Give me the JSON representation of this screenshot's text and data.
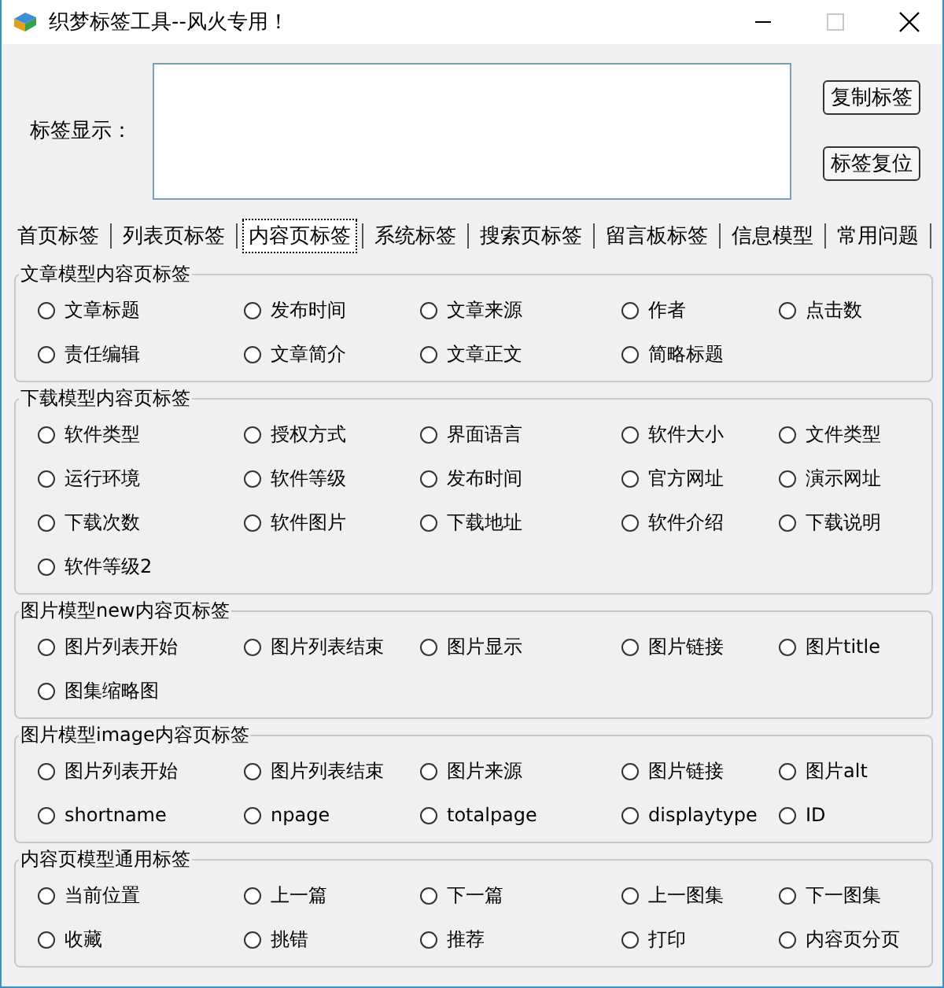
{
  "window": {
    "title": "织梦标签工具--风火专用！"
  },
  "display": {
    "label": "标签显示："
  },
  "buttons": [
    "复制标签",
    "标签复位"
  ],
  "tabs": [
    {
      "label": "首页标签",
      "selected": false
    },
    {
      "label": "列表页标签",
      "selected": false
    },
    {
      "label": "内容页标签",
      "selected": true
    },
    {
      "label": "系统标签",
      "selected": false
    },
    {
      "label": "搜索页标签",
      "selected": false
    },
    {
      "label": "留言板标签",
      "selected": false
    },
    {
      "label": "信息模型",
      "selected": false
    },
    {
      "label": "常用问题",
      "selected": false
    }
  ],
  "groups": [
    {
      "title": "文章模型内容页标签",
      "options": [
        {
          "label": "文章标题",
          "selected": false
        },
        {
          "label": "发布时间",
          "selected": false
        },
        {
          "label": "文章来源",
          "selected": false
        },
        {
          "label": "作者",
          "selected": false
        },
        {
          "label": "点击数",
          "selected": false
        },
        {
          "label": "责任编辑",
          "selected": false
        },
        {
          "label": "文章简介",
          "selected": false
        },
        {
          "label": "文章正文",
          "selected": false
        },
        {
          "label": "简略标题",
          "selected": false
        }
      ]
    },
    {
      "title": "下载模型内容页标签",
      "options": [
        {
          "label": "软件类型",
          "selected": false
        },
        {
          "label": "授权方式",
          "selected": false
        },
        {
          "label": "界面语言",
          "selected": false
        },
        {
          "label": "软件大小",
          "selected": false
        },
        {
          "label": "文件类型",
          "selected": false
        },
        {
          "label": "运行环境",
          "selected": false
        },
        {
          "label": "软件等级",
          "selected": false
        },
        {
          "label": "发布时间",
          "selected": false
        },
        {
          "label": "官方网址",
          "selected": false
        },
        {
          "label": "演示网址",
          "selected": false
        },
        {
          "label": "下载次数",
          "selected": false
        },
        {
          "label": "软件图片",
          "selected": false
        },
        {
          "label": "下载地址",
          "selected": false
        },
        {
          "label": "软件介绍",
          "selected": false
        },
        {
          "label": "下载说明",
          "selected": false
        },
        {
          "label": "软件等级2",
          "selected": false
        }
      ]
    },
    {
      "title": "图片模型new内容页标签",
      "options": [
        {
          "label": "图片列表开始",
          "selected": false
        },
        {
          "label": "图片列表结束",
          "selected": false
        },
        {
          "label": "图片显示",
          "selected": false
        },
        {
          "label": "图片链接",
          "selected": false
        },
        {
          "label": "图片title",
          "selected": false
        },
        {
          "label": "图集缩略图",
          "selected": false
        }
      ]
    },
    {
      "title": "图片模型image内容页标签",
      "options": [
        {
          "label": "图片列表开始",
          "selected": false
        },
        {
          "label": "图片列表结束",
          "selected": false
        },
        {
          "label": "图片来源",
          "selected": false
        },
        {
          "label": "图片链接",
          "selected": false
        },
        {
          "label": "图片alt",
          "selected": false
        },
        {
          "label": "shortname",
          "selected": false
        },
        {
          "label": "npage",
          "selected": false
        },
        {
          "label": "totalpage",
          "selected": false
        },
        {
          "label": "displaytype",
          "selected": false
        },
        {
          "label": "ID",
          "selected": false
        }
      ]
    },
    {
      "title": "内容页模型通用标签",
      "options": [
        {
          "label": "当前位置",
          "selected": false
        },
        {
          "label": "上一篇",
          "selected": false
        },
        {
          "label": "下一篇",
          "selected": false
        },
        {
          "label": "上一图集",
          "selected": false
        },
        {
          "label": "下一图集",
          "selected": false
        },
        {
          "label": "收藏",
          "selected": false
        },
        {
          "label": "挑错",
          "selected": false
        },
        {
          "label": "推荐",
          "selected": false
        },
        {
          "label": "打印",
          "selected": false
        },
        {
          "label": "内容页分页",
          "selected": false
        }
      ]
    }
  ]
}
